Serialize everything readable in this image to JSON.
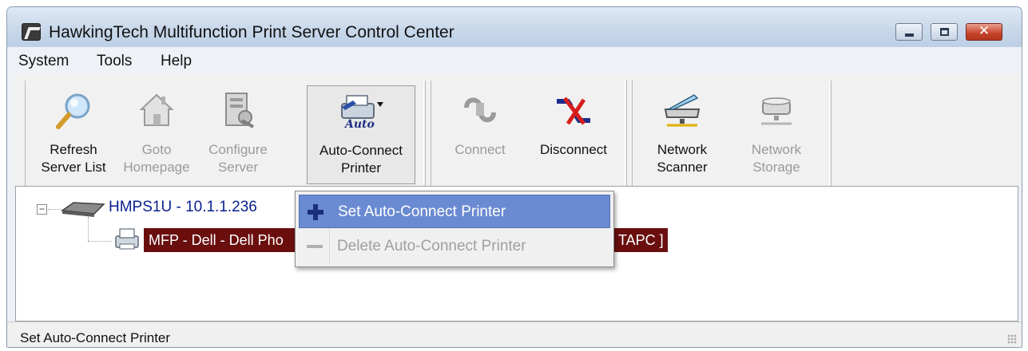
{
  "window": {
    "title": "HawkingTech Multifunction Print Server Control Center",
    "close_glyph": "✕",
    "buttons": [
      "minimize",
      "maximize",
      "close"
    ]
  },
  "menubar": {
    "items": [
      "System",
      "Tools",
      "Help"
    ]
  },
  "toolbar": {
    "groups": [
      {
        "buttons": [
          {
            "line1": "Refresh",
            "line2": "Server List",
            "icon": "magnifier-icon",
            "enabled": true
          },
          {
            "line1": "Goto",
            "line2": "Homepage",
            "icon": "home-icon",
            "enabled": false
          },
          {
            "line1": "Configure",
            "line2": "Server",
            "icon": "configure-icon",
            "enabled": false
          },
          {
            "line1": "Auto-Connect",
            "line2": "Printer",
            "icon": "auto-printer-icon",
            "enabled": true,
            "pressed": true,
            "icon_text": "Auto"
          }
        ]
      },
      {
        "buttons": [
          {
            "line1": "Connect",
            "icon": "connect-icon",
            "enabled": false
          },
          {
            "line1": "Disconnect",
            "icon": "disconnect-icon",
            "enabled": true
          }
        ]
      },
      {
        "buttons": [
          {
            "line1": "Network",
            "line2": "Scanner",
            "icon": "scanner-icon",
            "enabled": true
          },
          {
            "line1": "Network",
            "line2": "Storage",
            "icon": "storage-icon",
            "enabled": false
          }
        ]
      }
    ]
  },
  "tree": {
    "server_label": "HMPS1U - 10.1.1.236",
    "expander": "−",
    "printer_label_visible": "MFP - Dell - Dell Pho",
    "printer_label_tail": "TAPC ]"
  },
  "context_menu": {
    "items": [
      {
        "label": "Set Auto-Connect Printer",
        "icon": "plus-icon",
        "highlighted": true,
        "enabled": true
      },
      {
        "label": "Delete Auto-Connect Printer",
        "icon": "minus-icon",
        "highlighted": false,
        "enabled": false
      }
    ]
  },
  "statusbar": {
    "text": "Set Auto-Connect Printer"
  },
  "colors": {
    "selection_bg": "#6a0e0e",
    "menu_highlight": "#6a8ad1",
    "server_text": "#0a1f8f"
  }
}
